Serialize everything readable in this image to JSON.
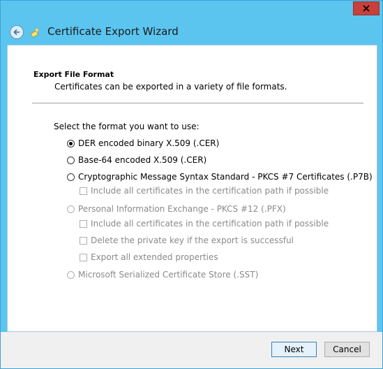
{
  "window": {
    "title": "Certificate Export Wizard",
    "accent_color": "#5bc5f0",
    "close_icon": "close-icon",
    "back_icon": "back-arrow-icon",
    "wizard_icon": "certificate-wizard-icon"
  },
  "page": {
    "heading": "Export File Format",
    "subheading": "Certificates can be exported in a variety of file formats.",
    "prompt": "Select the format you want to use:"
  },
  "options": {
    "der": {
      "label": "DER encoded binary X.509 (.CER)",
      "checked": true,
      "enabled": true
    },
    "base64": {
      "label": "Base-64 encoded X.509 (.CER)",
      "checked": false,
      "enabled": true
    },
    "pkcs7": {
      "label": "Cryptographic Message Syntax Standard - PKCS #7 Certificates (.P7B)",
      "checked": false,
      "enabled": true
    },
    "pkcs7_include": {
      "label": "Include all certificates in the certification path if possible",
      "checked": false,
      "enabled": false
    },
    "pfx": {
      "label": "Personal Information Exchange - PKCS #12 (.PFX)",
      "checked": false,
      "enabled": false
    },
    "pfx_include": {
      "label": "Include all certificates in the certification path if possible",
      "checked": false,
      "enabled": false
    },
    "pfx_delete_key": {
      "label": "Delete the private key if the export is successful",
      "checked": false,
      "enabled": false
    },
    "pfx_export_ext": {
      "label": "Export all extended properties",
      "checked": false,
      "enabled": false
    },
    "sst": {
      "label": "Microsoft Serialized Certificate Store (.SST)",
      "checked": false,
      "enabled": false
    }
  },
  "buttons": {
    "next": "Next",
    "cancel": "Cancel"
  }
}
